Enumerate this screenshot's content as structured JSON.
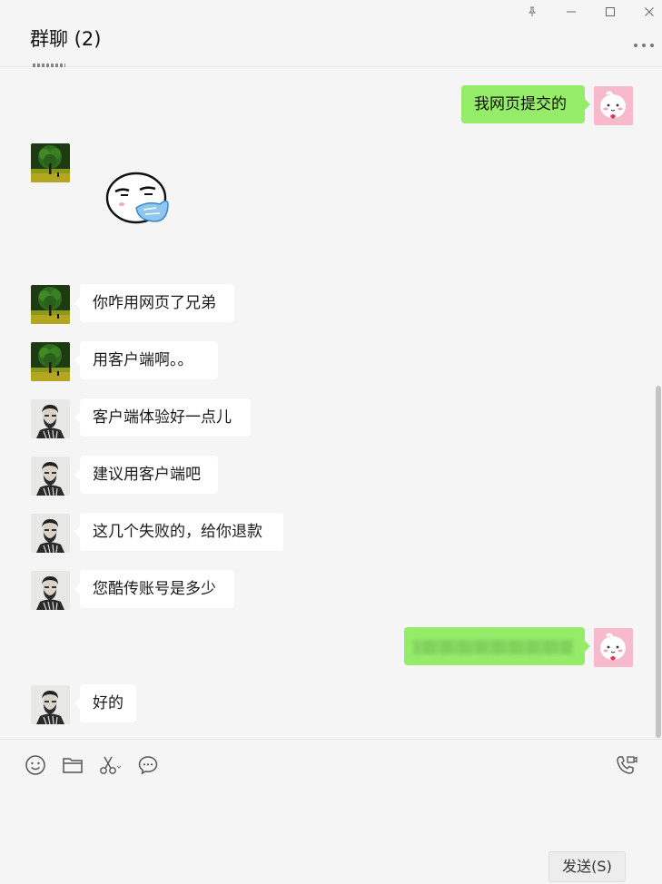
{
  "window": {
    "title": "群聊 (2)",
    "controls": [
      "pin-icon",
      "minimize-icon",
      "maximize-icon",
      "close-icon"
    ],
    "more_icon": "more-dots-icon"
  },
  "colors": {
    "self_bubble": "#95ec69",
    "other_bubble": "#ffffff",
    "background": "#f5f5f5"
  },
  "messages": [
    {
      "from": "self",
      "avatar": "cartoon-avatar",
      "text": "我网页提交的"
    },
    {
      "from": "user-tree",
      "avatar": "tree-avatar",
      "type": "sticker",
      "sticker": "bored-face-sticker"
    },
    {
      "from": "user-tree",
      "avatar": "tree-avatar",
      "text": "你咋用网页了兄弟"
    },
    {
      "from": "user-tree",
      "avatar": "tree-avatar",
      "text": "用客户端啊。。"
    },
    {
      "from": "user-beard",
      "avatar": "beard-avatar",
      "text": "客户端体验好一点儿"
    },
    {
      "from": "user-beard",
      "avatar": "beard-avatar",
      "text": "建议用客户端吧"
    },
    {
      "from": "user-beard",
      "avatar": "beard-avatar",
      "text": "这几个失败的，给你退款"
    },
    {
      "from": "user-beard",
      "avatar": "beard-avatar",
      "text": "您酷传账号是多少"
    },
    {
      "from": "self",
      "avatar": "cartoon-avatar",
      "text": "",
      "redacted": true
    },
    {
      "from": "user-beard",
      "avatar": "beard-avatar",
      "text": "好的"
    }
  ],
  "toolbar": {
    "icons": [
      "emoji-icon",
      "folder-icon",
      "scissors-icon",
      "chat-bubble-icon"
    ],
    "call_icon": "video-call-icon"
  },
  "send_button": {
    "label": "发送(S)"
  }
}
